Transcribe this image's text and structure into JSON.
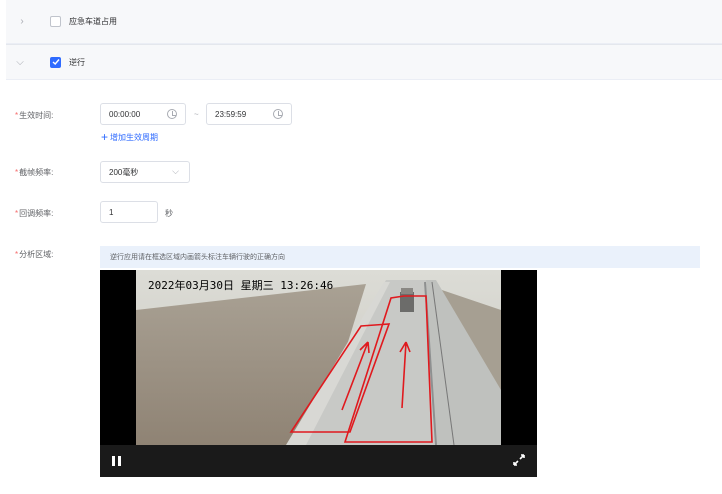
{
  "sections": [
    {
      "label": "应急车道占用",
      "checked": false,
      "expanded": false
    },
    {
      "label": "逆行",
      "checked": true,
      "expanded": true
    }
  ],
  "form": {
    "effective_time": {
      "label": "生效时间:",
      "start": "00:00:00",
      "separator": "~",
      "end": "23:59:59",
      "add_period": "增加生效周期"
    },
    "frame_rate": {
      "label": "截帧频率:",
      "value": "200毫秒"
    },
    "callback_rate": {
      "label": "回调频率:",
      "value": "1",
      "unit": "秒"
    },
    "analysis_area": {
      "label": "分析区域:",
      "tip": "逆行应用请在框选区域内画箭头标注车辆行驶的正确方向"
    }
  },
  "video": {
    "osd_text": "2022年03月30日  星期三  13:26:46"
  },
  "colors": {
    "primary": "#2f6bff",
    "required": "#f56c6c",
    "annotation": "#e0191e"
  },
  "icons": [
    "chevron-right-icon",
    "chevron-down-icon",
    "checkbox-icon",
    "clock-icon",
    "plus-icon",
    "dropdown-arrow-icon",
    "pause-icon",
    "fullscreen-icon"
  ]
}
